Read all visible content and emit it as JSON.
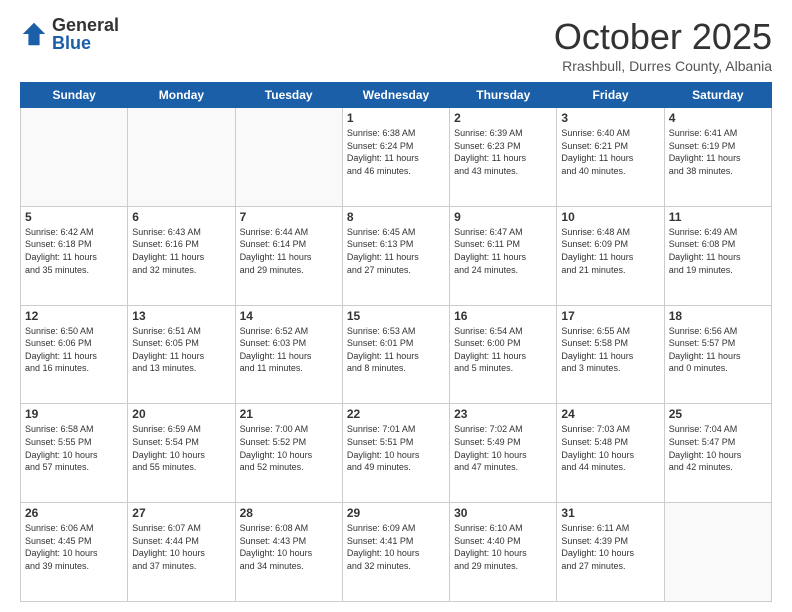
{
  "logo": {
    "general": "General",
    "blue": "Blue"
  },
  "header": {
    "month": "October 2025",
    "location": "Rrashbull, Durres County, Albania"
  },
  "days_of_week": [
    "Sunday",
    "Monday",
    "Tuesday",
    "Wednesday",
    "Thursday",
    "Friday",
    "Saturday"
  ],
  "weeks": [
    [
      {
        "day": "",
        "info": ""
      },
      {
        "day": "",
        "info": ""
      },
      {
        "day": "",
        "info": ""
      },
      {
        "day": "1",
        "info": "Sunrise: 6:38 AM\nSunset: 6:24 PM\nDaylight: 11 hours\nand 46 minutes."
      },
      {
        "day": "2",
        "info": "Sunrise: 6:39 AM\nSunset: 6:23 PM\nDaylight: 11 hours\nand 43 minutes."
      },
      {
        "day": "3",
        "info": "Sunrise: 6:40 AM\nSunset: 6:21 PM\nDaylight: 11 hours\nand 40 minutes."
      },
      {
        "day": "4",
        "info": "Sunrise: 6:41 AM\nSunset: 6:19 PM\nDaylight: 11 hours\nand 38 minutes."
      }
    ],
    [
      {
        "day": "5",
        "info": "Sunrise: 6:42 AM\nSunset: 6:18 PM\nDaylight: 11 hours\nand 35 minutes."
      },
      {
        "day": "6",
        "info": "Sunrise: 6:43 AM\nSunset: 6:16 PM\nDaylight: 11 hours\nand 32 minutes."
      },
      {
        "day": "7",
        "info": "Sunrise: 6:44 AM\nSunset: 6:14 PM\nDaylight: 11 hours\nand 29 minutes."
      },
      {
        "day": "8",
        "info": "Sunrise: 6:45 AM\nSunset: 6:13 PM\nDaylight: 11 hours\nand 27 minutes."
      },
      {
        "day": "9",
        "info": "Sunrise: 6:47 AM\nSunset: 6:11 PM\nDaylight: 11 hours\nand 24 minutes."
      },
      {
        "day": "10",
        "info": "Sunrise: 6:48 AM\nSunset: 6:09 PM\nDaylight: 11 hours\nand 21 minutes."
      },
      {
        "day": "11",
        "info": "Sunrise: 6:49 AM\nSunset: 6:08 PM\nDaylight: 11 hours\nand 19 minutes."
      }
    ],
    [
      {
        "day": "12",
        "info": "Sunrise: 6:50 AM\nSunset: 6:06 PM\nDaylight: 11 hours\nand 16 minutes."
      },
      {
        "day": "13",
        "info": "Sunrise: 6:51 AM\nSunset: 6:05 PM\nDaylight: 11 hours\nand 13 minutes."
      },
      {
        "day": "14",
        "info": "Sunrise: 6:52 AM\nSunset: 6:03 PM\nDaylight: 11 hours\nand 11 minutes."
      },
      {
        "day": "15",
        "info": "Sunrise: 6:53 AM\nSunset: 6:01 PM\nDaylight: 11 hours\nand 8 minutes."
      },
      {
        "day": "16",
        "info": "Sunrise: 6:54 AM\nSunset: 6:00 PM\nDaylight: 11 hours\nand 5 minutes."
      },
      {
        "day": "17",
        "info": "Sunrise: 6:55 AM\nSunset: 5:58 PM\nDaylight: 11 hours\nand 3 minutes."
      },
      {
        "day": "18",
        "info": "Sunrise: 6:56 AM\nSunset: 5:57 PM\nDaylight: 11 hours\nand 0 minutes."
      }
    ],
    [
      {
        "day": "19",
        "info": "Sunrise: 6:58 AM\nSunset: 5:55 PM\nDaylight: 10 hours\nand 57 minutes."
      },
      {
        "day": "20",
        "info": "Sunrise: 6:59 AM\nSunset: 5:54 PM\nDaylight: 10 hours\nand 55 minutes."
      },
      {
        "day": "21",
        "info": "Sunrise: 7:00 AM\nSunset: 5:52 PM\nDaylight: 10 hours\nand 52 minutes."
      },
      {
        "day": "22",
        "info": "Sunrise: 7:01 AM\nSunset: 5:51 PM\nDaylight: 10 hours\nand 49 minutes."
      },
      {
        "day": "23",
        "info": "Sunrise: 7:02 AM\nSunset: 5:49 PM\nDaylight: 10 hours\nand 47 minutes."
      },
      {
        "day": "24",
        "info": "Sunrise: 7:03 AM\nSunset: 5:48 PM\nDaylight: 10 hours\nand 44 minutes."
      },
      {
        "day": "25",
        "info": "Sunrise: 7:04 AM\nSunset: 5:47 PM\nDaylight: 10 hours\nand 42 minutes."
      }
    ],
    [
      {
        "day": "26",
        "info": "Sunrise: 6:06 AM\nSunset: 4:45 PM\nDaylight: 10 hours\nand 39 minutes."
      },
      {
        "day": "27",
        "info": "Sunrise: 6:07 AM\nSunset: 4:44 PM\nDaylight: 10 hours\nand 37 minutes."
      },
      {
        "day": "28",
        "info": "Sunrise: 6:08 AM\nSunset: 4:43 PM\nDaylight: 10 hours\nand 34 minutes."
      },
      {
        "day": "29",
        "info": "Sunrise: 6:09 AM\nSunset: 4:41 PM\nDaylight: 10 hours\nand 32 minutes."
      },
      {
        "day": "30",
        "info": "Sunrise: 6:10 AM\nSunset: 4:40 PM\nDaylight: 10 hours\nand 29 minutes."
      },
      {
        "day": "31",
        "info": "Sunrise: 6:11 AM\nSunset: 4:39 PM\nDaylight: 10 hours\nand 27 minutes."
      },
      {
        "day": "",
        "info": ""
      }
    ]
  ]
}
